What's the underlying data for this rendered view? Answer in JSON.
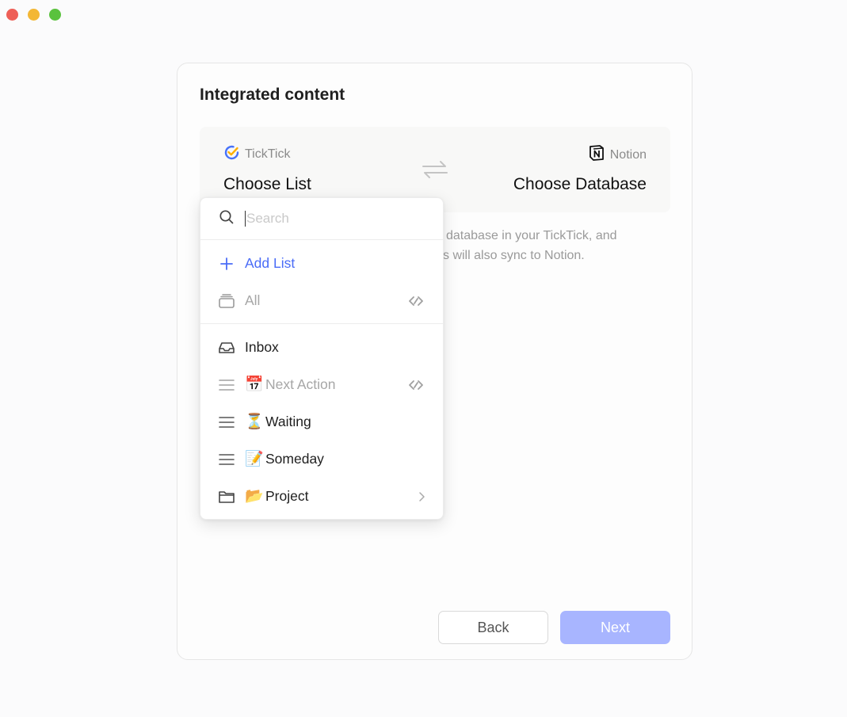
{
  "card": {
    "title": "Integrated content",
    "left_app": "TickTick",
    "right_app": "Notion",
    "left_choose": "Choose List",
    "right_choose": "Choose Database",
    "description_line1": "database in your TickTick, and",
    "description_line2": "s will also sync to Notion."
  },
  "dropdown": {
    "search_placeholder": "Search",
    "items": [
      {
        "label": "Add List",
        "icon": "plus-icon"
      },
      {
        "label": "All",
        "icon": "stack-icon",
        "trailing": "link-icon"
      },
      {
        "label": "Inbox",
        "icon": "inbox-icon"
      },
      {
        "label": "Next Action",
        "emoji": "📅",
        "icon": "list-icon",
        "trailing": "link-icon"
      },
      {
        "label": "Waiting",
        "emoji": "⏳",
        "icon": "list-icon"
      },
      {
        "label": "Someday",
        "emoji": "📝",
        "icon": "list-icon"
      },
      {
        "label": "Project",
        "emoji": "📂",
        "icon": "folder-icon",
        "trailing": "chevron-right-icon"
      }
    ]
  },
  "buttons": {
    "back": "Back",
    "next": "Next"
  },
  "colors": {
    "accent": "#4a6cf7",
    "next_button": "#a8b5ff",
    "ticktick_blue": "#4772fa",
    "ticktick_yellow": "#ffb000"
  }
}
